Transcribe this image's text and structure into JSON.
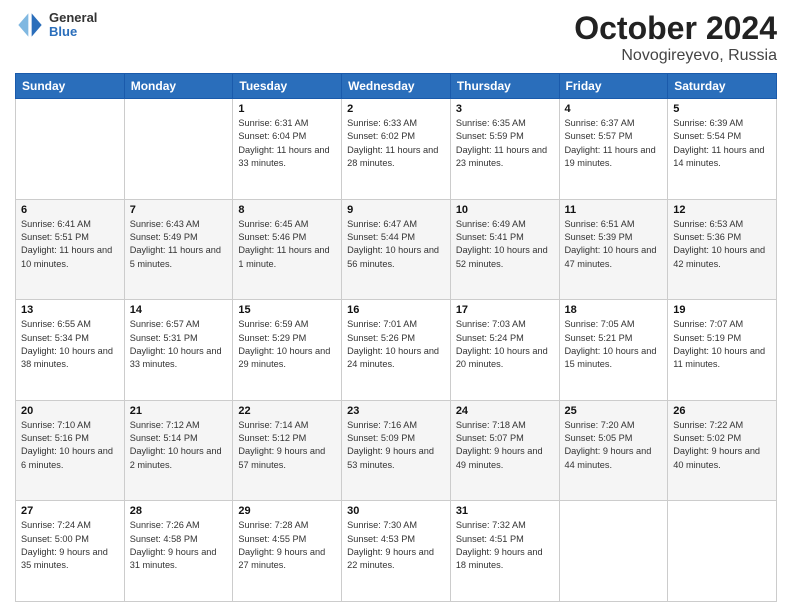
{
  "logo": {
    "general": "General",
    "blue": "Blue"
  },
  "header": {
    "month": "October 2024",
    "location": "Novogireyevo, Russia"
  },
  "weekdays": [
    "Sunday",
    "Monday",
    "Tuesday",
    "Wednesday",
    "Thursday",
    "Friday",
    "Saturday"
  ],
  "weeks": [
    [
      {
        "day": "",
        "info": ""
      },
      {
        "day": "",
        "info": ""
      },
      {
        "day": "1",
        "info": "Sunrise: 6:31 AM\nSunset: 6:04 PM\nDaylight: 11 hours and 33 minutes."
      },
      {
        "day": "2",
        "info": "Sunrise: 6:33 AM\nSunset: 6:02 PM\nDaylight: 11 hours and 28 minutes."
      },
      {
        "day": "3",
        "info": "Sunrise: 6:35 AM\nSunset: 5:59 PM\nDaylight: 11 hours and 23 minutes."
      },
      {
        "day": "4",
        "info": "Sunrise: 6:37 AM\nSunset: 5:57 PM\nDaylight: 11 hours and 19 minutes."
      },
      {
        "day": "5",
        "info": "Sunrise: 6:39 AM\nSunset: 5:54 PM\nDaylight: 11 hours and 14 minutes."
      }
    ],
    [
      {
        "day": "6",
        "info": "Sunrise: 6:41 AM\nSunset: 5:51 PM\nDaylight: 11 hours and 10 minutes."
      },
      {
        "day": "7",
        "info": "Sunrise: 6:43 AM\nSunset: 5:49 PM\nDaylight: 11 hours and 5 minutes."
      },
      {
        "day": "8",
        "info": "Sunrise: 6:45 AM\nSunset: 5:46 PM\nDaylight: 11 hours and 1 minute."
      },
      {
        "day": "9",
        "info": "Sunrise: 6:47 AM\nSunset: 5:44 PM\nDaylight: 10 hours and 56 minutes."
      },
      {
        "day": "10",
        "info": "Sunrise: 6:49 AM\nSunset: 5:41 PM\nDaylight: 10 hours and 52 minutes."
      },
      {
        "day": "11",
        "info": "Sunrise: 6:51 AM\nSunset: 5:39 PM\nDaylight: 10 hours and 47 minutes."
      },
      {
        "day": "12",
        "info": "Sunrise: 6:53 AM\nSunset: 5:36 PM\nDaylight: 10 hours and 42 minutes."
      }
    ],
    [
      {
        "day": "13",
        "info": "Sunrise: 6:55 AM\nSunset: 5:34 PM\nDaylight: 10 hours and 38 minutes."
      },
      {
        "day": "14",
        "info": "Sunrise: 6:57 AM\nSunset: 5:31 PM\nDaylight: 10 hours and 33 minutes."
      },
      {
        "day": "15",
        "info": "Sunrise: 6:59 AM\nSunset: 5:29 PM\nDaylight: 10 hours and 29 minutes."
      },
      {
        "day": "16",
        "info": "Sunrise: 7:01 AM\nSunset: 5:26 PM\nDaylight: 10 hours and 24 minutes."
      },
      {
        "day": "17",
        "info": "Sunrise: 7:03 AM\nSunset: 5:24 PM\nDaylight: 10 hours and 20 minutes."
      },
      {
        "day": "18",
        "info": "Sunrise: 7:05 AM\nSunset: 5:21 PM\nDaylight: 10 hours and 15 minutes."
      },
      {
        "day": "19",
        "info": "Sunrise: 7:07 AM\nSunset: 5:19 PM\nDaylight: 10 hours and 11 minutes."
      }
    ],
    [
      {
        "day": "20",
        "info": "Sunrise: 7:10 AM\nSunset: 5:16 PM\nDaylight: 10 hours and 6 minutes."
      },
      {
        "day": "21",
        "info": "Sunrise: 7:12 AM\nSunset: 5:14 PM\nDaylight: 10 hours and 2 minutes."
      },
      {
        "day": "22",
        "info": "Sunrise: 7:14 AM\nSunset: 5:12 PM\nDaylight: 9 hours and 57 minutes."
      },
      {
        "day": "23",
        "info": "Sunrise: 7:16 AM\nSunset: 5:09 PM\nDaylight: 9 hours and 53 minutes."
      },
      {
        "day": "24",
        "info": "Sunrise: 7:18 AM\nSunset: 5:07 PM\nDaylight: 9 hours and 49 minutes."
      },
      {
        "day": "25",
        "info": "Sunrise: 7:20 AM\nSunset: 5:05 PM\nDaylight: 9 hours and 44 minutes."
      },
      {
        "day": "26",
        "info": "Sunrise: 7:22 AM\nSunset: 5:02 PM\nDaylight: 9 hours and 40 minutes."
      }
    ],
    [
      {
        "day": "27",
        "info": "Sunrise: 7:24 AM\nSunset: 5:00 PM\nDaylight: 9 hours and 35 minutes."
      },
      {
        "day": "28",
        "info": "Sunrise: 7:26 AM\nSunset: 4:58 PM\nDaylight: 9 hours and 31 minutes."
      },
      {
        "day": "29",
        "info": "Sunrise: 7:28 AM\nSunset: 4:55 PM\nDaylight: 9 hours and 27 minutes."
      },
      {
        "day": "30",
        "info": "Sunrise: 7:30 AM\nSunset: 4:53 PM\nDaylight: 9 hours and 22 minutes."
      },
      {
        "day": "31",
        "info": "Sunrise: 7:32 AM\nSunset: 4:51 PM\nDaylight: 9 hours and 18 minutes."
      },
      {
        "day": "",
        "info": ""
      },
      {
        "day": "",
        "info": ""
      }
    ]
  ]
}
